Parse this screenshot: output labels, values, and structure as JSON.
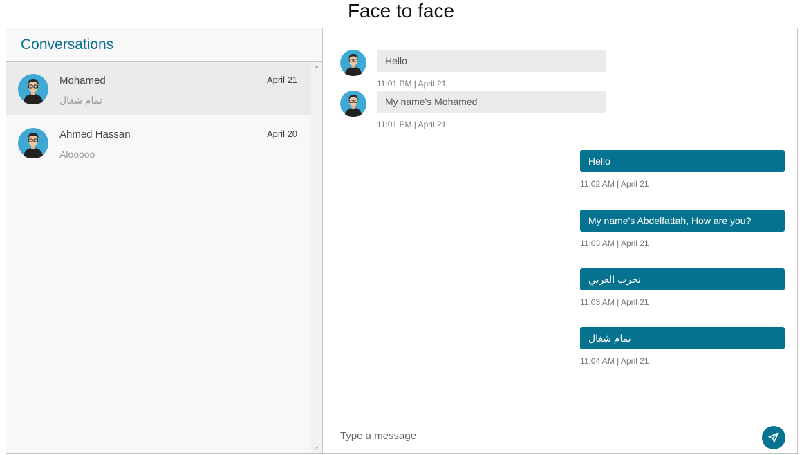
{
  "page": {
    "title": "Face to face"
  },
  "sidebar": {
    "title": "Conversations",
    "conversations": [
      {
        "name": "Mohamed",
        "date": "April 21",
        "preview": "تمام شغال",
        "active": true
      },
      {
        "name": "Ahmed Hassan",
        "date": "April 20",
        "preview": "Alooooo",
        "active": false
      }
    ]
  },
  "chat": {
    "incoming": [
      {
        "text": "Hello",
        "time": "11:01 PM | April 21"
      },
      {
        "text": "My name's Mohamed",
        "time": "11:01 PM | April 21"
      }
    ],
    "outgoing": [
      {
        "text": "Hello",
        "time": "11:02 AM | April 21"
      },
      {
        "text": "My name's Abdelfattah, How are you?",
        "time": "11:03 AM | April 21"
      },
      {
        "text": "نجرب العربي",
        "time": "11:03 AM | April 21"
      },
      {
        "text": "تمام شغال",
        "time": "11:04 AM | April 21"
      }
    ]
  },
  "composer": {
    "placeholder": "Type a message",
    "value": ""
  },
  "icons": {
    "avatar": "user-avatar-icon",
    "send": "paper-plane-icon",
    "scroll_up": "triangle-up-icon",
    "scroll_down": "triangle-down-icon"
  },
  "colors": {
    "accent": "#05728f",
    "title": "#0b6f93",
    "incoming_bubble": "#ebebeb",
    "sidebar_bg": "#f8f8f8",
    "active_item": "#ebebeb"
  }
}
